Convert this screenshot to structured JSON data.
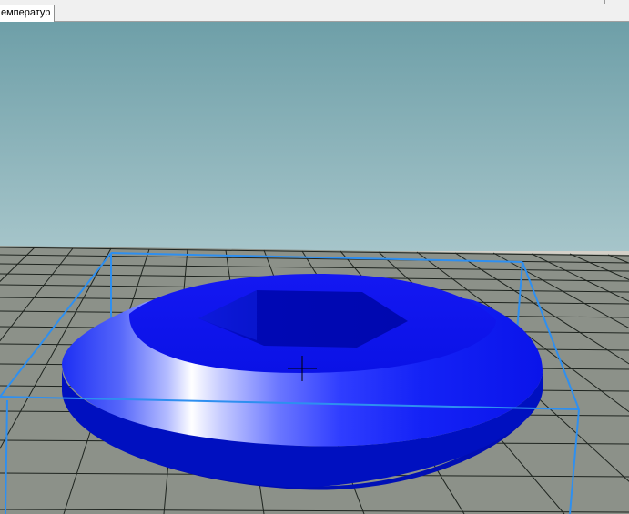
{
  "tabs": [
    {
      "label": "емператур"
    }
  ],
  "viewport": {
    "sky_top_color": "#6e9fa8",
    "sky_bottom_color": "#a4c3c9",
    "floor_color": "#8c9189",
    "grid_color": "#1e241f",
    "bbox_color": "#2e8ff0",
    "part_color": "#0a14f0"
  }
}
